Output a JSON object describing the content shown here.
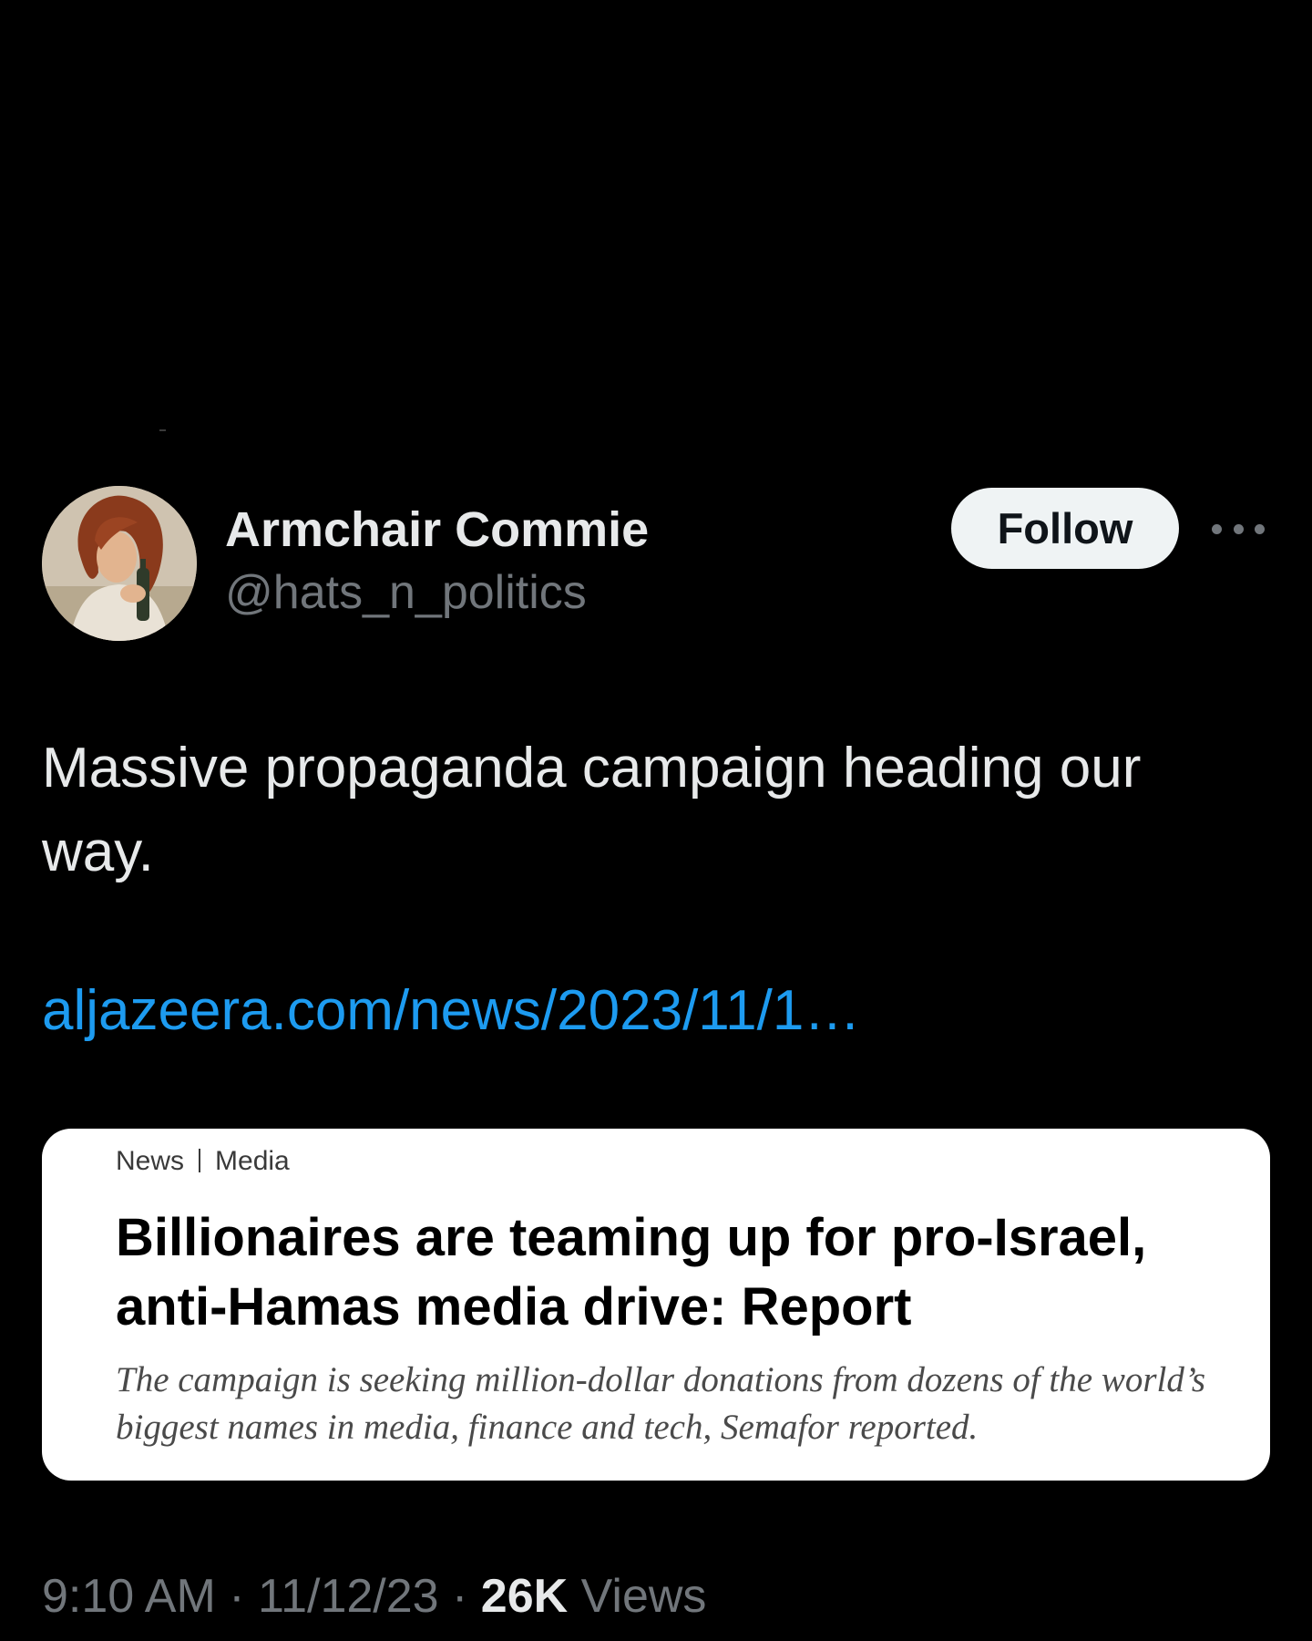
{
  "author": {
    "name": "Armchair Commie",
    "handle": "@hats_n_politics"
  },
  "actions": {
    "follow_label": "Follow",
    "more_icon": "more-horizontal-icon"
  },
  "tweet": {
    "text": "Massive propaganda campaign heading our way.",
    "link": "aljazeera.com/news/2023/11/1…"
  },
  "link_card": {
    "section": "News",
    "subsection": "Media",
    "headline": "Billionaires are teaming up for pro-Israel, anti-Hamas media drive: Report",
    "summary": "The campaign is seeking million-dollar donations from dozens of the world’s biggest names in media, finance and tech, Semafor reported."
  },
  "meta": {
    "time": "9:10 AM",
    "date": "11/12/23",
    "views_count": "26K",
    "views_label": "Views"
  },
  "colors": {
    "background": "#000000",
    "link": "#1d9bf0",
    "muted_text": "#71767b",
    "primary_text": "#e7e9ea",
    "follow_button_bg": "#eff3f4"
  }
}
